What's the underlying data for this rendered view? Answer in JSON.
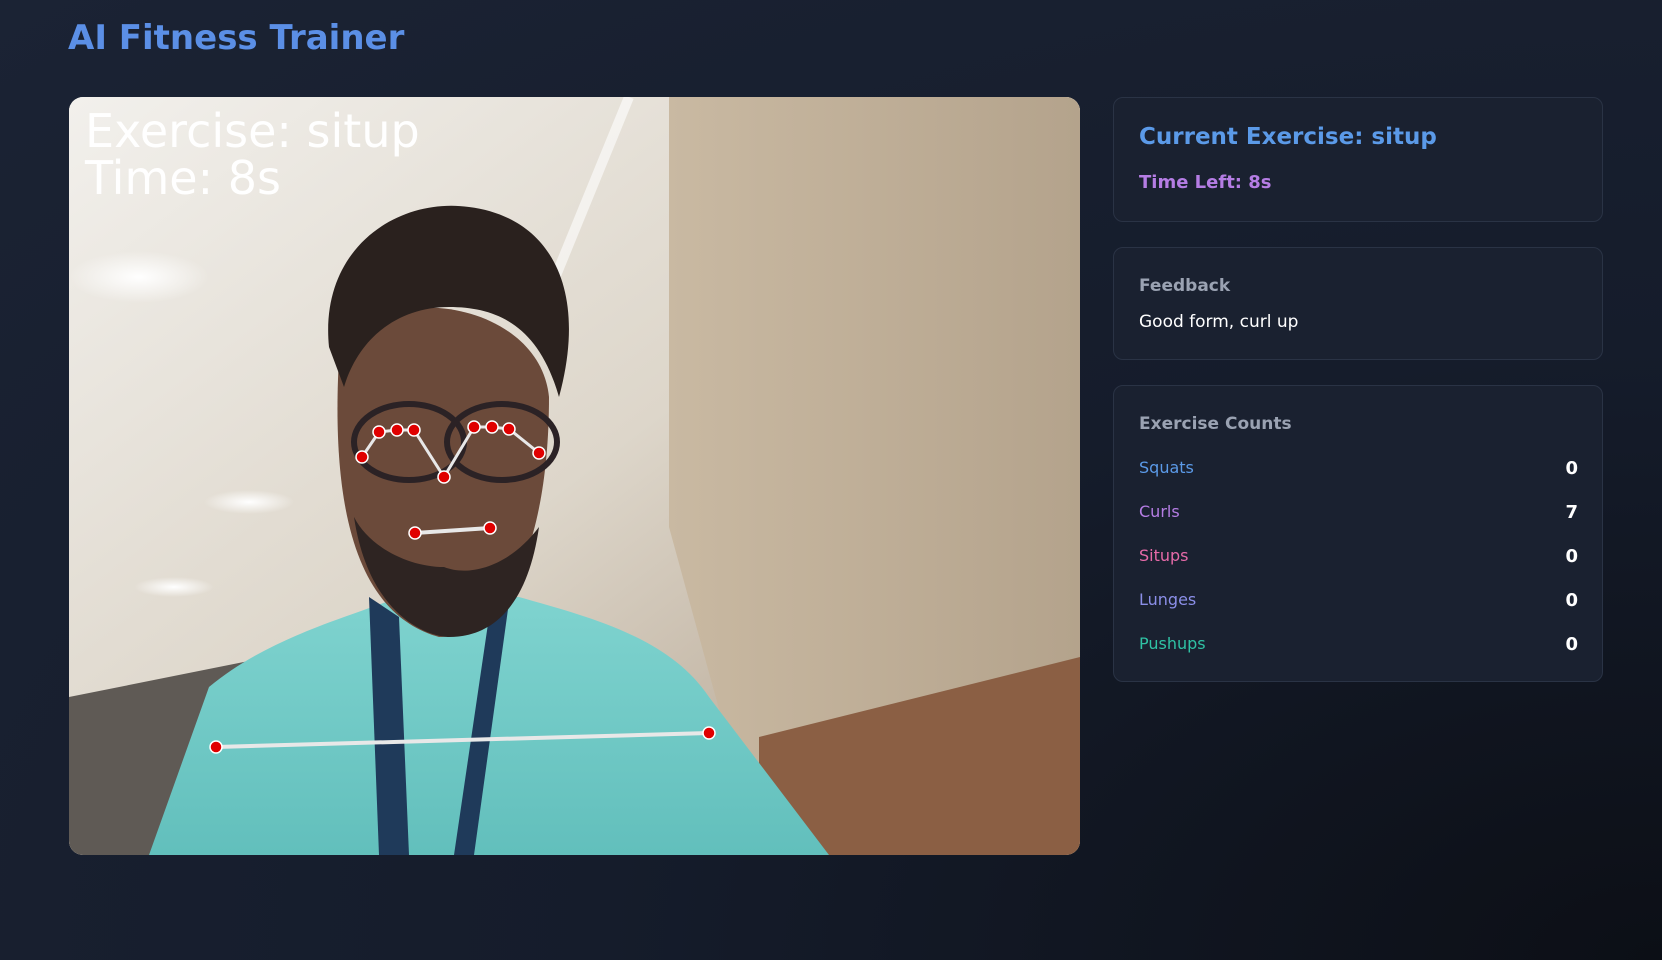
{
  "header": {
    "title": "AI Fitness Trainer"
  },
  "video": {
    "overlay_exercise": "Exercise: situp",
    "overlay_time": "Time: 8s"
  },
  "status": {
    "current_exercise": "Current Exercise: situp",
    "time_left": "Time Left: 8s"
  },
  "feedback": {
    "title": "Feedback",
    "text": "Good form, curl up"
  },
  "counts": {
    "title": "Exercise Counts",
    "items": [
      {
        "label": "Squats",
        "value": "0",
        "color": "#5b9ae8"
      },
      {
        "label": "Curls",
        "value": "7",
        "color": "#b57de4"
      },
      {
        "label": "Situps",
        "value": "0",
        "color": "#e66aa8"
      },
      {
        "label": "Lunges",
        "value": "0",
        "color": "#8b8fe8"
      },
      {
        "label": "Pushups",
        "value": "0",
        "color": "#2fc2a4"
      }
    ]
  }
}
